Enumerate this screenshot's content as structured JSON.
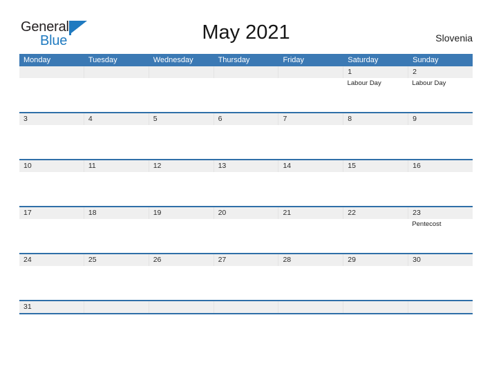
{
  "brand": {
    "name_part1": "General",
    "name_part2": "Blue",
    "flag_icon": "blue-triangle-flag-icon",
    "primary_color": "#1f7ac0",
    "header_color": "#3b79b4",
    "rule_color": "#2f6fa8",
    "date_band_color": "#efefef"
  },
  "header": {
    "title": "May 2021",
    "country": "Slovenia"
  },
  "calendar": {
    "weekdays": [
      "Monday",
      "Tuesday",
      "Wednesday",
      "Thursday",
      "Friday",
      "Saturday",
      "Sunday"
    ],
    "weeks": [
      {
        "days": [
          {
            "date": "",
            "events": []
          },
          {
            "date": "",
            "events": []
          },
          {
            "date": "",
            "events": []
          },
          {
            "date": "",
            "events": []
          },
          {
            "date": "",
            "events": []
          },
          {
            "date": "1",
            "events": [
              "Labour Day"
            ]
          },
          {
            "date": "2",
            "events": [
              "Labour Day"
            ]
          }
        ]
      },
      {
        "days": [
          {
            "date": "3",
            "events": []
          },
          {
            "date": "4",
            "events": []
          },
          {
            "date": "5",
            "events": []
          },
          {
            "date": "6",
            "events": []
          },
          {
            "date": "7",
            "events": []
          },
          {
            "date": "8",
            "events": []
          },
          {
            "date": "9",
            "events": []
          }
        ]
      },
      {
        "days": [
          {
            "date": "10",
            "events": []
          },
          {
            "date": "11",
            "events": []
          },
          {
            "date": "12",
            "events": []
          },
          {
            "date": "13",
            "events": []
          },
          {
            "date": "14",
            "events": []
          },
          {
            "date": "15",
            "events": []
          },
          {
            "date": "16",
            "events": []
          }
        ]
      },
      {
        "days": [
          {
            "date": "17",
            "events": []
          },
          {
            "date": "18",
            "events": []
          },
          {
            "date": "19",
            "events": []
          },
          {
            "date": "20",
            "events": []
          },
          {
            "date": "21",
            "events": []
          },
          {
            "date": "22",
            "events": []
          },
          {
            "date": "23",
            "events": [
              "Pentecost"
            ]
          }
        ]
      },
      {
        "days": [
          {
            "date": "24",
            "events": []
          },
          {
            "date": "25",
            "events": []
          },
          {
            "date": "26",
            "events": []
          },
          {
            "date": "27",
            "events": []
          },
          {
            "date": "28",
            "events": []
          },
          {
            "date": "29",
            "events": []
          },
          {
            "date": "30",
            "events": []
          }
        ]
      },
      {
        "last": true,
        "days": [
          {
            "date": "31",
            "events": []
          },
          {
            "date": "",
            "events": []
          },
          {
            "date": "",
            "events": []
          },
          {
            "date": "",
            "events": []
          },
          {
            "date": "",
            "events": []
          },
          {
            "date": "",
            "events": []
          },
          {
            "date": "",
            "events": []
          }
        ]
      }
    ]
  }
}
